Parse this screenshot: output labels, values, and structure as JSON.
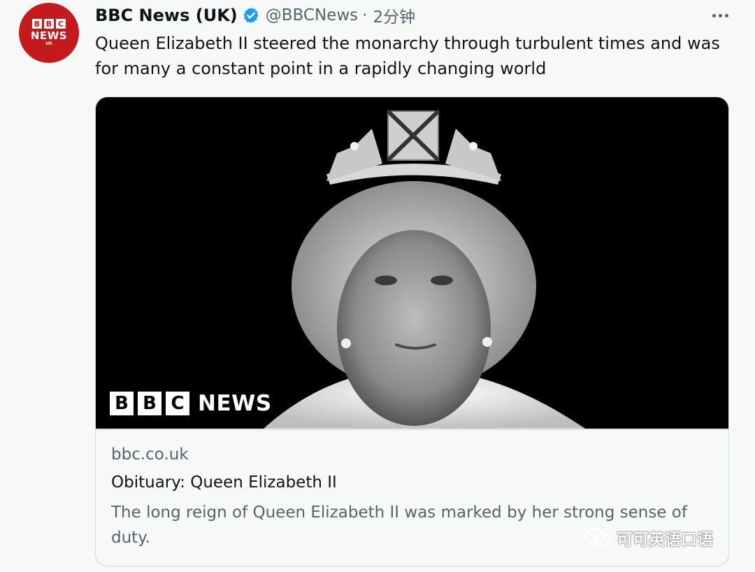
{
  "author": {
    "name": "BBC News (UK)",
    "handle": "@BBCNews",
    "separator": "·",
    "time_ago": "2分钟",
    "avatar": {
      "blocks": [
        "B",
        "B",
        "C"
      ],
      "word": "NEWS",
      "sub": "UK"
    }
  },
  "tweet": {
    "text": "Queen Elizabeth II steered the monarchy through turbulent times and was for many a constant point in a rapidly changing world"
  },
  "card": {
    "logo": {
      "blocks": [
        "B",
        "B",
        "C"
      ],
      "word": "NEWS"
    },
    "domain": "bbc.co.uk",
    "title": "Obituary: Queen Elizabeth II",
    "description": "The long reign of Queen Elizabeth II was marked by her strong sense of duty."
  },
  "watermark": {
    "text": "可可英语口语"
  },
  "colors": {
    "verified": "#1d9bf0",
    "avatar_bg": "#c4191d",
    "secondary_text": "#536471",
    "border": "#cfd9de"
  }
}
